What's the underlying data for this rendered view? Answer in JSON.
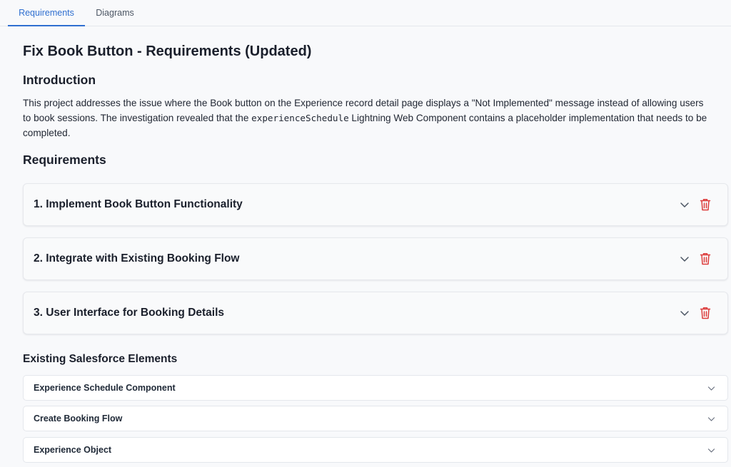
{
  "tabs": [
    {
      "label": "Requirements",
      "active": true
    },
    {
      "label": "Diagrams",
      "active": false
    }
  ],
  "page": {
    "title": "Fix Book Button - Requirements (Updated)"
  },
  "introduction": {
    "heading": "Introduction",
    "text_before": "This project addresses the issue where the Book button on the Experience record detail page displays a \"Not Implemented\" message instead of allowing users to book sessions. The investigation revealed that the ",
    "code": "experienceSchedule",
    "text_after": " Lightning Web Component contains a placeholder implementation that needs to be completed."
  },
  "requirements": {
    "heading": "Requirements",
    "items": [
      {
        "label": "1. Implement Book Button Functionality",
        "icons": [
          "chevron-down-icon",
          "trash-icon"
        ]
      },
      {
        "label": "2. Integrate with Existing Booking Flow",
        "icons": [
          "chevron-down-icon",
          "trash-icon"
        ]
      },
      {
        "label": "3. User Interface for Booking Details",
        "icons": [
          "chevron-down-icon",
          "trash-icon"
        ]
      }
    ]
  },
  "existing_elements": {
    "heading": "Existing Salesforce Elements",
    "items": [
      {
        "label": "Experience Schedule Component"
      },
      {
        "label": "Create Booking Flow"
      },
      {
        "label": "Experience Object"
      }
    ]
  },
  "colors": {
    "accent": "#2f6fd0",
    "delete": "#dc3b3b",
    "background": "#f8f9fb"
  }
}
